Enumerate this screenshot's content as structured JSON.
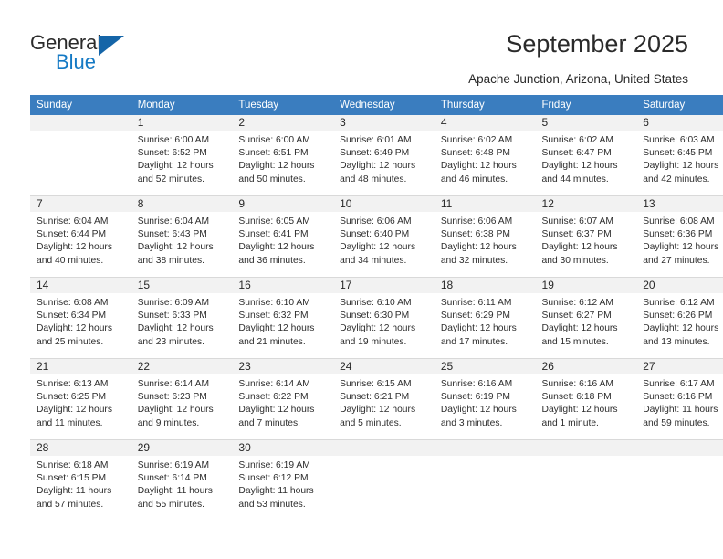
{
  "brand": {
    "name_top": "General",
    "name_bottom": "Blue",
    "accent_color": "#1479c4",
    "triangle_color": "#1565a8"
  },
  "header": {
    "title": "September 2025",
    "subtitle": "Apache Junction, Arizona, United States"
  },
  "calendar": {
    "header_bg": "#3a7dbf",
    "daynum_band_bg": "#f2f2f2",
    "weekday_headers": [
      "Sunday",
      "Monday",
      "Tuesday",
      "Wednesday",
      "Thursday",
      "Friday",
      "Saturday"
    ],
    "weeks": [
      [
        {
          "day": "",
          "sunrise": "",
          "sunset": "",
          "daylight_l1": "",
          "daylight_l2": "",
          "empty": true
        },
        {
          "day": "1",
          "sunrise": "Sunrise: 6:00 AM",
          "sunset": "Sunset: 6:52 PM",
          "daylight_l1": "Daylight: 12 hours",
          "daylight_l2": "and 52 minutes."
        },
        {
          "day": "2",
          "sunrise": "Sunrise: 6:00 AM",
          "sunset": "Sunset: 6:51 PM",
          "daylight_l1": "Daylight: 12 hours",
          "daylight_l2": "and 50 minutes."
        },
        {
          "day": "3",
          "sunrise": "Sunrise: 6:01 AM",
          "sunset": "Sunset: 6:49 PM",
          "daylight_l1": "Daylight: 12 hours",
          "daylight_l2": "and 48 minutes."
        },
        {
          "day": "4",
          "sunrise": "Sunrise: 6:02 AM",
          "sunset": "Sunset: 6:48 PM",
          "daylight_l1": "Daylight: 12 hours",
          "daylight_l2": "and 46 minutes."
        },
        {
          "day": "5",
          "sunrise": "Sunrise: 6:02 AM",
          "sunset": "Sunset: 6:47 PM",
          "daylight_l1": "Daylight: 12 hours",
          "daylight_l2": "and 44 minutes."
        },
        {
          "day": "6",
          "sunrise": "Sunrise: 6:03 AM",
          "sunset": "Sunset: 6:45 PM",
          "daylight_l1": "Daylight: 12 hours",
          "daylight_l2": "and 42 minutes."
        }
      ],
      [
        {
          "day": "7",
          "sunrise": "Sunrise: 6:04 AM",
          "sunset": "Sunset: 6:44 PM",
          "daylight_l1": "Daylight: 12 hours",
          "daylight_l2": "and 40 minutes."
        },
        {
          "day": "8",
          "sunrise": "Sunrise: 6:04 AM",
          "sunset": "Sunset: 6:43 PM",
          "daylight_l1": "Daylight: 12 hours",
          "daylight_l2": "and 38 minutes."
        },
        {
          "day": "9",
          "sunrise": "Sunrise: 6:05 AM",
          "sunset": "Sunset: 6:41 PM",
          "daylight_l1": "Daylight: 12 hours",
          "daylight_l2": "and 36 minutes."
        },
        {
          "day": "10",
          "sunrise": "Sunrise: 6:06 AM",
          "sunset": "Sunset: 6:40 PM",
          "daylight_l1": "Daylight: 12 hours",
          "daylight_l2": "and 34 minutes."
        },
        {
          "day": "11",
          "sunrise": "Sunrise: 6:06 AM",
          "sunset": "Sunset: 6:38 PM",
          "daylight_l1": "Daylight: 12 hours",
          "daylight_l2": "and 32 minutes."
        },
        {
          "day": "12",
          "sunrise": "Sunrise: 6:07 AM",
          "sunset": "Sunset: 6:37 PM",
          "daylight_l1": "Daylight: 12 hours",
          "daylight_l2": "and 30 minutes."
        },
        {
          "day": "13",
          "sunrise": "Sunrise: 6:08 AM",
          "sunset": "Sunset: 6:36 PM",
          "daylight_l1": "Daylight: 12 hours",
          "daylight_l2": "and 27 minutes."
        }
      ],
      [
        {
          "day": "14",
          "sunrise": "Sunrise: 6:08 AM",
          "sunset": "Sunset: 6:34 PM",
          "daylight_l1": "Daylight: 12 hours",
          "daylight_l2": "and 25 minutes."
        },
        {
          "day": "15",
          "sunrise": "Sunrise: 6:09 AM",
          "sunset": "Sunset: 6:33 PM",
          "daylight_l1": "Daylight: 12 hours",
          "daylight_l2": "and 23 minutes."
        },
        {
          "day": "16",
          "sunrise": "Sunrise: 6:10 AM",
          "sunset": "Sunset: 6:32 PM",
          "daylight_l1": "Daylight: 12 hours",
          "daylight_l2": "and 21 minutes."
        },
        {
          "day": "17",
          "sunrise": "Sunrise: 6:10 AM",
          "sunset": "Sunset: 6:30 PM",
          "daylight_l1": "Daylight: 12 hours",
          "daylight_l2": "and 19 minutes."
        },
        {
          "day": "18",
          "sunrise": "Sunrise: 6:11 AM",
          "sunset": "Sunset: 6:29 PM",
          "daylight_l1": "Daylight: 12 hours",
          "daylight_l2": "and 17 minutes."
        },
        {
          "day": "19",
          "sunrise": "Sunrise: 6:12 AM",
          "sunset": "Sunset: 6:27 PM",
          "daylight_l1": "Daylight: 12 hours",
          "daylight_l2": "and 15 minutes."
        },
        {
          "day": "20",
          "sunrise": "Sunrise: 6:12 AM",
          "sunset": "Sunset: 6:26 PM",
          "daylight_l1": "Daylight: 12 hours",
          "daylight_l2": "and 13 minutes."
        }
      ],
      [
        {
          "day": "21",
          "sunrise": "Sunrise: 6:13 AM",
          "sunset": "Sunset: 6:25 PM",
          "daylight_l1": "Daylight: 12 hours",
          "daylight_l2": "and 11 minutes."
        },
        {
          "day": "22",
          "sunrise": "Sunrise: 6:14 AM",
          "sunset": "Sunset: 6:23 PM",
          "daylight_l1": "Daylight: 12 hours",
          "daylight_l2": "and 9 minutes."
        },
        {
          "day": "23",
          "sunrise": "Sunrise: 6:14 AM",
          "sunset": "Sunset: 6:22 PM",
          "daylight_l1": "Daylight: 12 hours",
          "daylight_l2": "and 7 minutes."
        },
        {
          "day": "24",
          "sunrise": "Sunrise: 6:15 AM",
          "sunset": "Sunset: 6:21 PM",
          "daylight_l1": "Daylight: 12 hours",
          "daylight_l2": "and 5 minutes."
        },
        {
          "day": "25",
          "sunrise": "Sunrise: 6:16 AM",
          "sunset": "Sunset: 6:19 PM",
          "daylight_l1": "Daylight: 12 hours",
          "daylight_l2": "and 3 minutes."
        },
        {
          "day": "26",
          "sunrise": "Sunrise: 6:16 AM",
          "sunset": "Sunset: 6:18 PM",
          "daylight_l1": "Daylight: 12 hours",
          "daylight_l2": "and 1 minute."
        },
        {
          "day": "27",
          "sunrise": "Sunrise: 6:17 AM",
          "sunset": "Sunset: 6:16 PM",
          "daylight_l1": "Daylight: 11 hours",
          "daylight_l2": "and 59 minutes."
        }
      ],
      [
        {
          "day": "28",
          "sunrise": "Sunrise: 6:18 AM",
          "sunset": "Sunset: 6:15 PM",
          "daylight_l1": "Daylight: 11 hours",
          "daylight_l2": "and 57 minutes."
        },
        {
          "day": "29",
          "sunrise": "Sunrise: 6:19 AM",
          "sunset": "Sunset: 6:14 PM",
          "daylight_l1": "Daylight: 11 hours",
          "daylight_l2": "and 55 minutes."
        },
        {
          "day": "30",
          "sunrise": "Sunrise: 6:19 AM",
          "sunset": "Sunset: 6:12 PM",
          "daylight_l1": "Daylight: 11 hours",
          "daylight_l2": "and 53 minutes."
        },
        {
          "day": "",
          "sunrise": "",
          "sunset": "",
          "daylight_l1": "",
          "daylight_l2": "",
          "empty": true
        },
        {
          "day": "",
          "sunrise": "",
          "sunset": "",
          "daylight_l1": "",
          "daylight_l2": "",
          "empty": true
        },
        {
          "day": "",
          "sunrise": "",
          "sunset": "",
          "daylight_l1": "",
          "daylight_l2": "",
          "empty": true
        },
        {
          "day": "",
          "sunrise": "",
          "sunset": "",
          "daylight_l1": "",
          "daylight_l2": "",
          "empty": true
        }
      ]
    ]
  }
}
